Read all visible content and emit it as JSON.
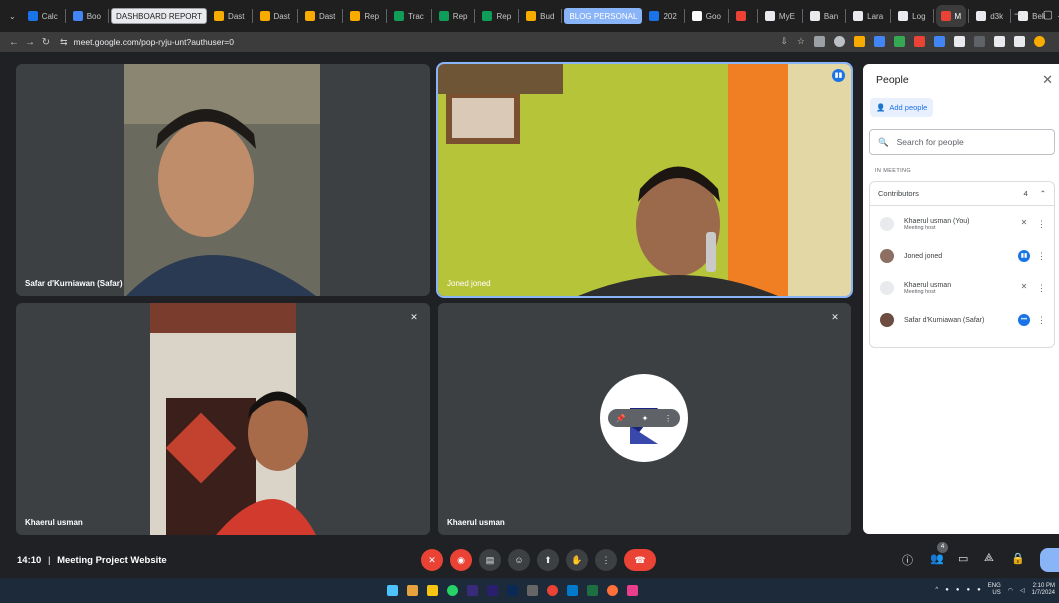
{
  "browser": {
    "tabs": [
      {
        "label": "Calc",
        "color": "#1a73e8"
      },
      {
        "label": "Boo",
        "color": "#4285f4"
      },
      {
        "label": "DASHBOARD REPORT",
        "style": "pill"
      },
      {
        "label": "Dast",
        "color": "#f9ab00"
      },
      {
        "label": "Dast",
        "color": "#f9ab00"
      },
      {
        "label": "Dast",
        "color": "#f9ab00"
      },
      {
        "label": "Rep",
        "color": "#f9ab00"
      },
      {
        "label": "Trac",
        "color": "#0f9d58"
      },
      {
        "label": "Rep",
        "color": "#0f9d58"
      },
      {
        "label": "Rep",
        "color": "#0f9d58"
      },
      {
        "label": "Bud",
        "color": "#f9ab00"
      },
      {
        "label": "BLOG PERSONAL",
        "style": "pill-blue"
      },
      {
        "label": "202",
        "color": "#1a73e8"
      },
      {
        "label": "Goo",
        "color": "#fff"
      },
      {
        "label": "",
        "color": "#ea4335"
      },
      {
        "label": "MyE",
        "color": "#e8eaed"
      },
      {
        "label": "Ban",
        "color": "#e8eaed"
      },
      {
        "label": "Lara",
        "color": "#e8eaed"
      },
      {
        "label": "Log",
        "color": "#e8eaed"
      },
      {
        "label": "M",
        "color": "#ea4335",
        "active": true
      },
      {
        "label": "d3k",
        "color": "#e8eaed"
      },
      {
        "label": "Beli",
        "color": "#e8eaed"
      }
    ],
    "new_tab": "+",
    "window_controls": [
      "–",
      "▢"
    ],
    "url": "meet.google.com/pop-ryju-unt?authuser=0"
  },
  "tiles": [
    {
      "name": "Safar d'Kurniawan (Safar)",
      "muted": false,
      "speaking": false
    },
    {
      "name": "Joned joned",
      "muted": false,
      "speaking": true
    },
    {
      "name": "Khaerul usman",
      "muted": true,
      "speaking": false
    },
    {
      "name": "Khaerul usman",
      "muted": true,
      "speaking": false
    }
  ],
  "people_panel": {
    "title": "People",
    "add_people": "Add people",
    "search_placeholder": "Search for people",
    "section": "IN MEETING",
    "group": "Contributors",
    "group_count": "4",
    "participants": [
      {
        "name": "Khaerul usman (You)",
        "role": "Meeting host",
        "status": "muted",
        "avatar": "#e8eaed"
      },
      {
        "name": "Joned joned",
        "role": "",
        "status": "speaking",
        "avatar": "#8d6e63"
      },
      {
        "name": "Khaerul usman",
        "role": "Meeting host",
        "status": "muted",
        "avatar": "#e8eaed"
      },
      {
        "name": "Safar d'Kurniawan (Safar)",
        "role": "",
        "status": "more",
        "avatar": "#6d4c41"
      }
    ]
  },
  "controls": {
    "time": "14:10",
    "separator": "|",
    "meeting_name": "Meeting Project Website",
    "people_badge": "4"
  },
  "taskbar": {
    "lang": "ENG",
    "region": "US",
    "time": "2:10 PM",
    "date": "1/7/2024"
  }
}
